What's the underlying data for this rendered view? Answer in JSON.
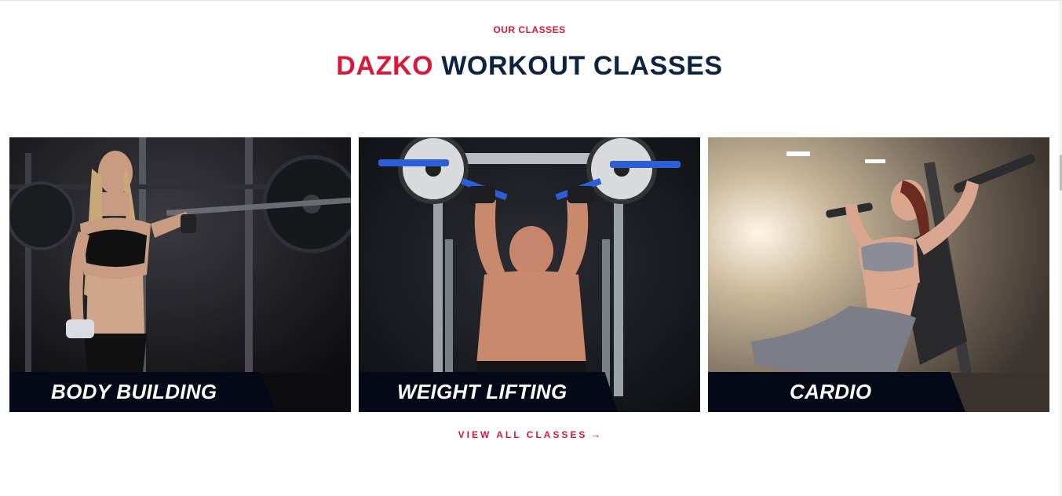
{
  "section": {
    "eyebrow": "OUR CLASSES",
    "heading_accent": "DAZKO",
    "heading_main": "WORKOUT CLASSES"
  },
  "classes": [
    {
      "label": "BODY BUILDING"
    },
    {
      "label": "WEIGHT LIFTING"
    },
    {
      "label": "CARDIO"
    }
  ],
  "cta": {
    "label": "VIEW ALL CLASSES",
    "icon": "arrow-right-icon"
  },
  "colors": {
    "accent": "#d71a3a",
    "heading": "#0c2340",
    "label_bar": "#050816"
  }
}
